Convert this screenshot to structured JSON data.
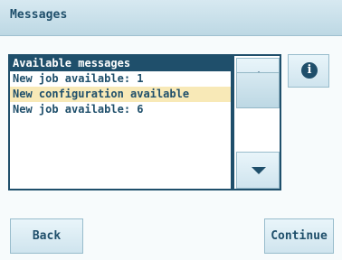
{
  "header": {
    "title": "Messages"
  },
  "messages": {
    "header": "Available messages",
    "items": [
      "New job available: 1",
      "New configuration available",
      "New job available: 6"
    ],
    "selected_index": 1
  },
  "buttons": {
    "info_label": "i",
    "back_label": "Back",
    "continue_label": "Continue"
  },
  "icons": {
    "info": "info-icon",
    "scroll_up": "chevron-up-icon",
    "scroll_down": "chevron-down-icon"
  }
}
